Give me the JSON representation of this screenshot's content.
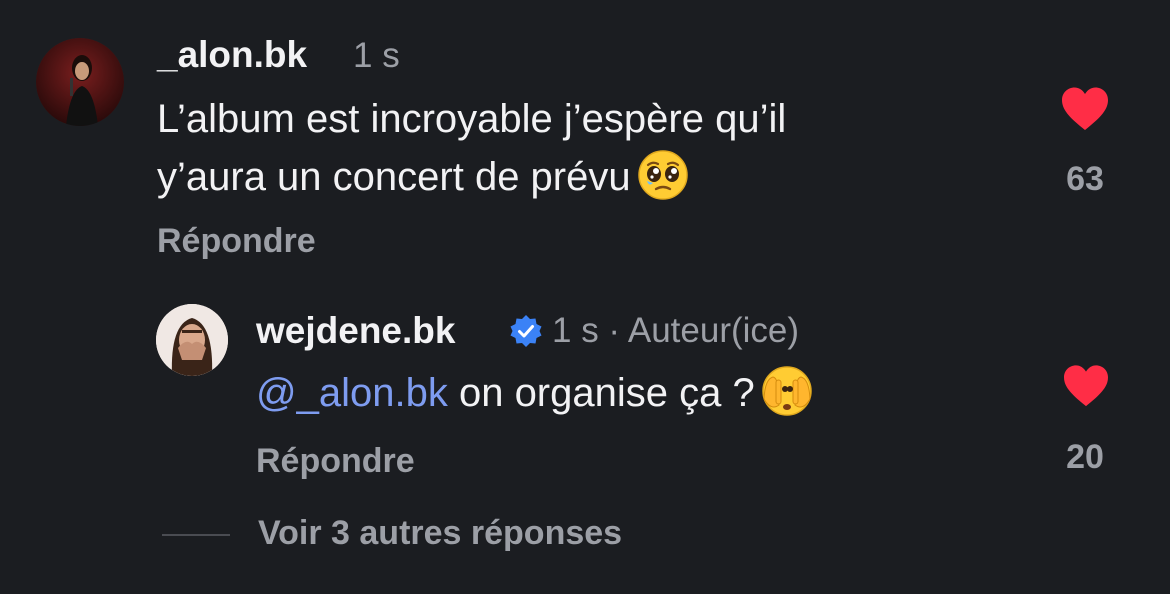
{
  "comment": {
    "username": "_alon.bk",
    "time": "1 s",
    "text_line1": "L’album est incroyable j’espère qu’il",
    "text_line2": "y’aura un concert de prévu",
    "emoji": "pleading-face-emoji",
    "reply_label": "Répondre",
    "like_count": "63",
    "liked": true
  },
  "reply": {
    "username": "wejdene.bk",
    "verified": true,
    "meta": "1 s · Auteur(ice)",
    "mention": "@_alon.bk",
    "text": " on organise ça ?",
    "emoji": "face-with-peeking-eye-emoji",
    "reply_label": "Répondre",
    "like_count": "20",
    "liked": true
  },
  "more_replies": {
    "label": "Voir 3 autres réponses"
  },
  "colors": {
    "background": "#1b1d21",
    "heart": "#ff2d46",
    "mention": "#7e9cf0",
    "verified": "#3b82f6",
    "muted": "#9c9fa6"
  }
}
